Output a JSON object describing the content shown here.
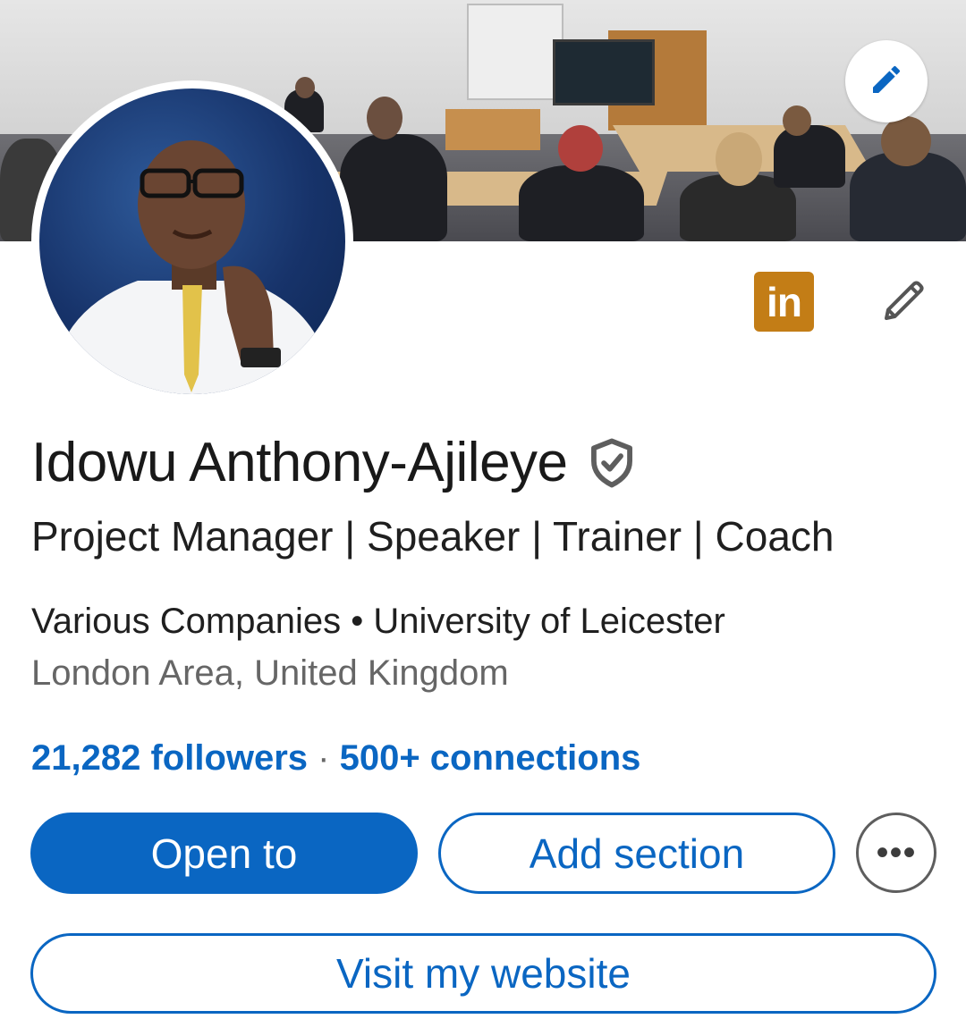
{
  "profile": {
    "name": "Idowu Anthony-Ajileye",
    "headline": "Project Manager | Speaker | Trainer | Coach",
    "company_line": "Various Companies • University of Leicester",
    "location": "London Area, United Kingdom",
    "followers": "21,282 followers",
    "separator": " · ",
    "connections": "500+ connections"
  },
  "badge": {
    "label": "in",
    "color": "#c37d16"
  },
  "actions": {
    "open_to": "Open to",
    "add_section": "Add section",
    "more": "•••",
    "visit_website": "Visit my website"
  },
  "icons": {
    "cover_edit": "pencil-icon",
    "profile_edit": "pencil-outline-icon",
    "verified": "verified-shield-icon",
    "more": "ellipsis-icon"
  },
  "colors": {
    "accent": "#0a66c2",
    "text_primary": "#191919",
    "text_secondary": "#666666"
  }
}
